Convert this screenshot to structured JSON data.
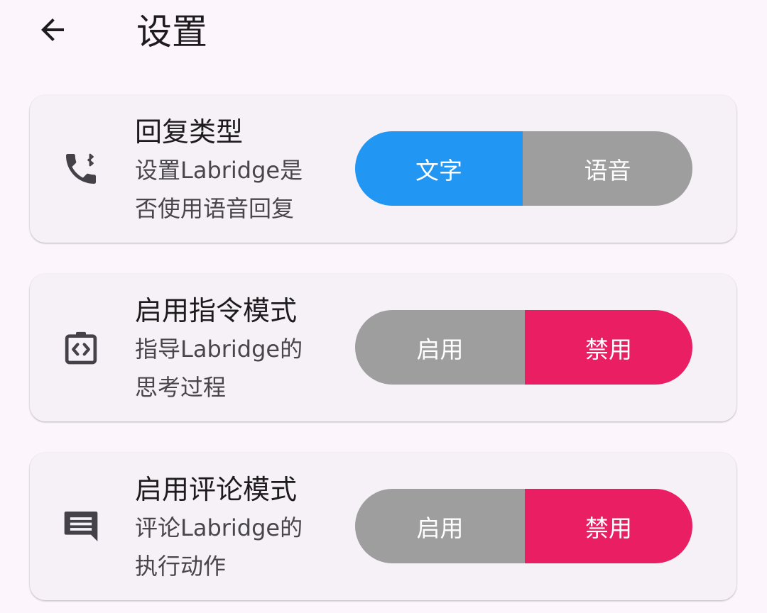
{
  "header": {
    "back_icon": "arrow-back-icon",
    "title": "设置"
  },
  "colors": {
    "background": "#fcf6fc",
    "card": "#f5f1f6",
    "selected_blue": "#2196f3",
    "selected_pink": "#e91e63",
    "unselected_grey": "#9e9e9e"
  },
  "settings": [
    {
      "icon": "phone-bluetooth-icon",
      "title": "回复类型",
      "desc_line1": "设置Labridge是",
      "desc_line2": "否使用语音回复",
      "options": [
        "文字",
        "语音"
      ],
      "selected": "文字"
    },
    {
      "icon": "code-clipboard-icon",
      "title": "启用指令模式",
      "desc_line1": "指导Labridge的",
      "desc_line2": "思考过程",
      "options": [
        "启用",
        "禁用"
      ],
      "selected": "禁用"
    },
    {
      "icon": "comment-icon",
      "title": "启用评论模式",
      "desc_line1": "评论Labridge的",
      "desc_line2": "执行动作",
      "options": [
        "启用",
        "禁用"
      ],
      "selected": "禁用"
    }
  ]
}
